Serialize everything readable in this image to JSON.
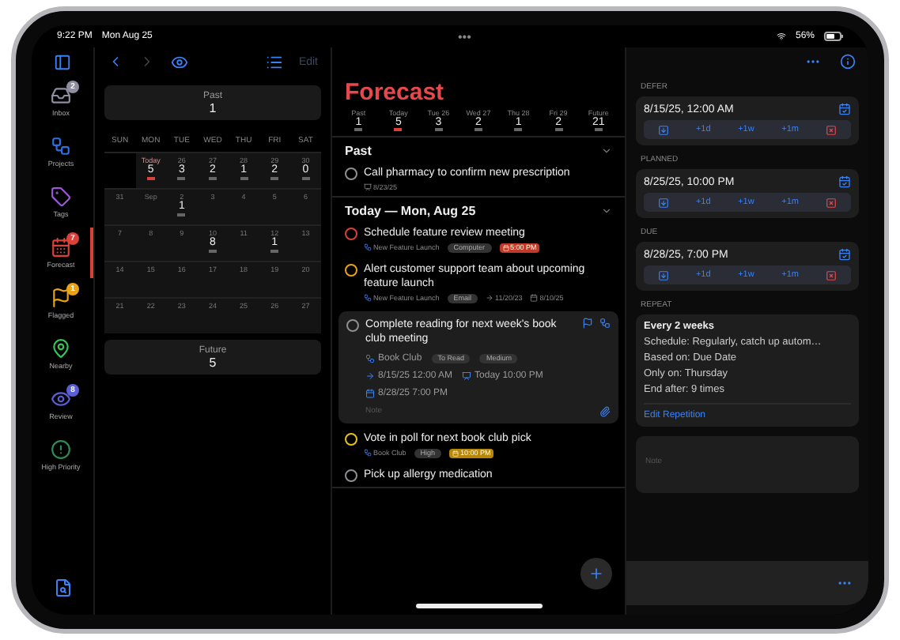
{
  "status_bar": {
    "time": "9:22 PM",
    "date": "Mon Aug 25",
    "dots": "•••",
    "battery": "56%"
  },
  "toolbar": {
    "edit": {
      "label": "Edit",
      "disabled": true
    }
  },
  "sidebar": {
    "items": [
      {
        "kind": "inbox",
        "label": "Inbox",
        "badge": "2",
        "color": "#8e8ea0",
        "selected": false
      },
      {
        "kind": "projects",
        "label": "Projects",
        "color": "#2f6fe0",
        "selected": false
      },
      {
        "kind": "tags",
        "label": "Tags",
        "color": "#9b59d6",
        "selected": false
      },
      {
        "kind": "forecast",
        "label": "Forecast",
        "badge": "7",
        "color": "#d9413b",
        "selected": true
      },
      {
        "kind": "flagged",
        "label": "Flagged",
        "badge": "1",
        "color": "#e8a317",
        "selected": false
      },
      {
        "kind": "nearby",
        "label": "Nearby",
        "color": "#34c759",
        "selected": false
      },
      {
        "kind": "review",
        "label": "Review",
        "badge": "8",
        "color": "#5b5fd6",
        "selected": false
      },
      {
        "kind": "priority",
        "label": "High Priority",
        "color": "#2e8b57",
        "selected": false
      }
    ]
  },
  "calendar": {
    "past": {
      "label": "Past",
      "count": "1"
    },
    "weekdays": [
      "SUN",
      "MON",
      "TUE",
      "WED",
      "THU",
      "FRI",
      "SAT"
    ],
    "weeks": [
      [
        {
          "kind": "blank"
        },
        {
          "kind": "day",
          "label": "Today",
          "count": "5",
          "today": true
        },
        {
          "kind": "day",
          "label": "26",
          "count": "3",
          "today": false
        },
        {
          "kind": "day",
          "label": "27",
          "count": "2",
          "today": false
        },
        {
          "kind": "day",
          "label": "28",
          "count": "1",
          "today": false
        },
        {
          "kind": "day",
          "label": "29",
          "count": "2",
          "today": false
        },
        {
          "kind": "day",
          "label": "30",
          "count": "0",
          "today": false
        }
      ],
      [
        {
          "kind": "day",
          "label": "31",
          "today": false
        },
        {
          "kind": "day",
          "label": "Sep",
          "today": false
        },
        {
          "kind": "day",
          "label": "2",
          "count": "1",
          "today": false
        },
        {
          "kind": "day",
          "label": "3",
          "today": false
        },
        {
          "kind": "day",
          "label": "4",
          "today": false
        },
        {
          "kind": "day",
          "label": "5",
          "today": false
        },
        {
          "kind": "day",
          "label": "6",
          "today": false
        }
      ],
      [
        {
          "kind": "day",
          "label": "7",
          "today": false
        },
        {
          "kind": "day",
          "label": "8",
          "today": false
        },
        {
          "kind": "day",
          "label": "9",
          "today": false
        },
        {
          "kind": "day",
          "label": "10",
          "count": "8",
          "today": false
        },
        {
          "kind": "day",
          "label": "11",
          "today": false
        },
        {
          "kind": "day",
          "label": "12",
          "count": "1",
          "today": false
        },
        {
          "kind": "day",
          "label": "13",
          "today": false
        }
      ],
      [
        {
          "kind": "day",
          "label": "14",
          "today": false
        },
        {
          "kind": "day",
          "label": "15",
          "today": false
        },
        {
          "kind": "day",
          "label": "16",
          "today": false
        },
        {
          "kind": "day",
          "label": "17",
          "today": false
        },
        {
          "kind": "day",
          "label": "18",
          "today": false
        },
        {
          "kind": "day",
          "label": "19",
          "today": false
        },
        {
          "kind": "day",
          "label": "20",
          "today": false
        }
      ],
      [
        {
          "kind": "day",
          "label": "21",
          "today": false
        },
        {
          "kind": "day",
          "label": "22",
          "today": false
        },
        {
          "kind": "day",
          "label": "23",
          "today": false
        },
        {
          "kind": "day",
          "label": "24",
          "today": false
        },
        {
          "kind": "day",
          "label": "25",
          "today": false
        },
        {
          "kind": "day",
          "label": "26",
          "today": false
        },
        {
          "kind": "day",
          "label": "27",
          "today": false
        }
      ]
    ],
    "future": {
      "label": "Future",
      "count": "5"
    }
  },
  "forecast": {
    "title": "Forecast",
    "days": [
      {
        "label": "Past",
        "count": "1",
        "selected": false
      },
      {
        "label": "Today",
        "count": "5",
        "selected": true
      },
      {
        "label": "Tue 26",
        "count": "3",
        "selected": false
      },
      {
        "label": "Wed 27",
        "count": "2",
        "selected": false
      },
      {
        "label": "Thu 28",
        "count": "1",
        "selected": false
      },
      {
        "label": "Fri 29",
        "count": "2",
        "selected": false
      },
      {
        "label": "Future",
        "count": "21",
        "selected": false
      }
    ],
    "sections": [
      {
        "title": "Past",
        "tasks": [
          {
            "title": "Call pharmacy to confirm new prescription",
            "color": "#8e8e93",
            "expanded": false,
            "meta": [
              {
                "kind": "planned",
                "text": "8/23/25"
              }
            ]
          }
        ]
      },
      {
        "title": "Today — Mon, Aug 25",
        "tasks": [
          {
            "title": "Schedule feature review meeting",
            "color": "#d9413b",
            "expanded": false,
            "meta": [
              {
                "kind": "project",
                "text": "New Feature Launch"
              },
              {
                "kind": "tag",
                "text": "Computer"
              },
              {
                "kind": "due",
                "text": "5:00 PM",
                "color": "#c0392b"
              }
            ]
          },
          {
            "title": "Alert customer support team about upcoming feature launch",
            "color": "#e8a317",
            "expanded": false,
            "meta": [
              {
                "kind": "project",
                "text": "New Feature Launch"
              },
              {
                "kind": "tag",
                "text": "Email"
              },
              {
                "kind": "defer",
                "text": "11/20/23"
              },
              {
                "kind": "date",
                "text": "8/10/25"
              }
            ]
          },
          {
            "title": "Complete reading for next week's book club meeting",
            "color": "#8e8e93",
            "expanded": true,
            "detail": {
              "project": "Book Club",
              "tags": [
                "To Read",
                "Medium"
              ],
              "defer": "8/15/25 12:00 AM",
              "planned": "Today 10:00 PM",
              "due": "8/28/25 7:00 PM",
              "note_placeholder": "Note"
            }
          },
          {
            "title": "Vote in poll for next book club pick",
            "color": "#e8c217",
            "expanded": false,
            "meta": [
              {
                "kind": "project",
                "text": "Book Club"
              },
              {
                "kind": "tag",
                "text": "High"
              },
              {
                "kind": "due",
                "text": "10:00 PM",
                "color": "#b8860b"
              }
            ]
          },
          {
            "title": "Pick up allergy medication",
            "color": "#8e8e93",
            "expanded": false
          }
        ]
      }
    ]
  },
  "inspector": {
    "dates": [
      {
        "label": "DEFER",
        "value": "8/15/25, 12:00 AM",
        "quick": [
          "+1d",
          "+1w",
          "+1m"
        ]
      },
      {
        "label": "PLANNED",
        "value": "8/25/25, 10:00 PM",
        "quick": [
          "+1d",
          "+1w",
          "+1m"
        ]
      },
      {
        "label": "DUE",
        "value": "8/28/25, 7:00 PM",
        "quick": [
          "+1d",
          "+1w",
          "+1m"
        ]
      }
    ],
    "repeat": {
      "label": "REPEAT",
      "title": "Every 2 weeks",
      "lines": [
        "Schedule: Regularly, catch up autom…",
        "Based on: Due Date",
        "Only on: Thursday",
        "End after: 9 times"
      ],
      "link": "Edit Repetition"
    },
    "note_placeholder": "Note"
  }
}
